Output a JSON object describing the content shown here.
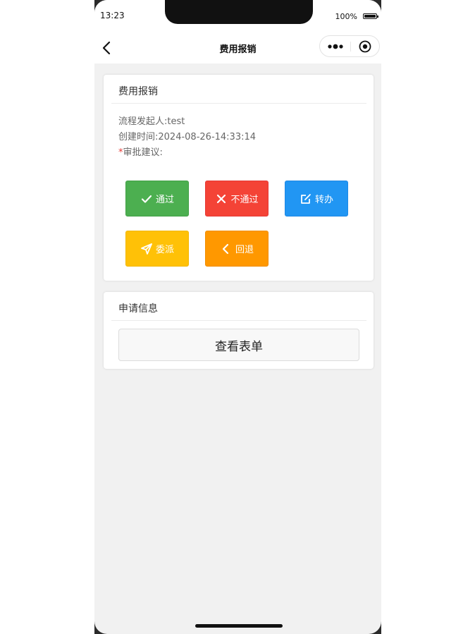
{
  "status_bar": {
    "time": "13:23",
    "battery_percent": "100%",
    "battery_level": 1.0
  },
  "nav": {
    "title": "费用报销",
    "icons": {
      "back": "chevron-left-icon",
      "more": "more-dots-icon",
      "close": "target-circle-icon"
    }
  },
  "approval_card": {
    "title": "费用报销",
    "initiator_label": "流程发起人:",
    "initiator": "test",
    "created_label": "创建时间:",
    "created_time": "2024-08-26-14:33:14",
    "required_mark": "*",
    "comment_label": "审批建议:",
    "actions": [
      {
        "label": "通过",
        "icon": "check-icon",
        "color": "#4caf50"
      },
      {
        "label": "不通过",
        "icon": "close-icon",
        "color": "#f44336"
      },
      {
        "label": "转办",
        "icon": "edit-icon",
        "color": "#2196f3"
      },
      {
        "label": "委派",
        "icon": "send-icon",
        "color": "#ffc107"
      },
      {
        "label": "回退",
        "icon": "chevron-left-icon",
        "color": "#ff9800"
      }
    ]
  },
  "application_card": {
    "title": "申请信息",
    "view_form_label": "查看表单"
  },
  "colors": {
    "page_background": "#f1f1f1",
    "card_background": "#ffffff",
    "required": "#e53935"
  }
}
